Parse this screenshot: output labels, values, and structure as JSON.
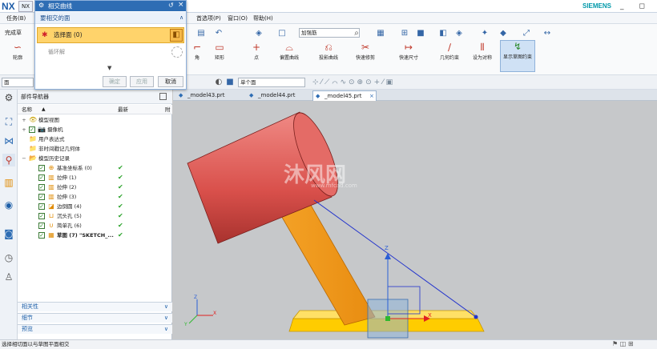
{
  "app": {
    "logo": "NX",
    "tab": "NX",
    "brand": "SIEMENS",
    "window_controls": "_ ◻ ✕"
  },
  "menubar": {
    "items": [
      "任务(B)",
      "首选项(P)",
      "窗口(O)",
      "帮助(H)"
    ]
  },
  "ribbon": {
    "left_label": "完成草",
    "buttons": [
      "轮廓",
      "角",
      "矩形",
      "点",
      "偏置曲线",
      "投影曲线",
      "快速修剪",
      "快速尺寸",
      "几何约束",
      "设为对称",
      "显示草图约束"
    ],
    "combo_value": "加强筋"
  },
  "selbar": {
    "filter_value": "面",
    "scope_value": "单个面"
  },
  "dialog": {
    "title": "相交曲线",
    "section": "要相交的面",
    "select_label": "选择面 (0)",
    "ring_label": "循环解",
    "buttons": [
      "确定",
      "应用",
      "取消"
    ]
  },
  "navigator": {
    "title": "部件导航器",
    "col_name": "名称",
    "col_latest": "最新",
    "col_extra": "附",
    "rows": [
      {
        "label": "模型视图",
        "indent": 0,
        "expander": "+",
        "check": false,
        "icon": "👁",
        "latest": ""
      },
      {
        "label": "摄像机",
        "indent": 0,
        "expander": "+",
        "check": true,
        "icon": "📷",
        "latest": ""
      },
      {
        "label": "用户表达式",
        "indent": 0,
        "expander": "",
        "check": false,
        "icon": "📁",
        "latest": ""
      },
      {
        "label": "非时间戳记几何体",
        "indent": 0,
        "expander": "",
        "check": false,
        "icon": "📁",
        "latest": ""
      },
      {
        "label": "模型历史记录",
        "indent": 0,
        "expander": "−",
        "check": false,
        "icon": "📂",
        "latest": ""
      },
      {
        "label": "基准坐标系 (0)",
        "indent": 1,
        "expander": "",
        "check": true,
        "icon": "⊕",
        "latest": "✔"
      },
      {
        "label": "拉伸 (1)",
        "indent": 1,
        "expander": "",
        "check": true,
        "icon": "▥",
        "latest": "✔"
      },
      {
        "label": "拉伸 (2)",
        "indent": 1,
        "expander": "",
        "check": true,
        "icon": "▥",
        "latest": "✔"
      },
      {
        "label": "拉伸 (3)",
        "indent": 1,
        "expander": "",
        "check": true,
        "icon": "▥",
        "latest": "✔"
      },
      {
        "label": "边倒圆 (4)",
        "indent": 1,
        "expander": "",
        "check": true,
        "icon": "◪",
        "latest": "✔"
      },
      {
        "label": "沉头孔 (5)",
        "indent": 1,
        "expander": "",
        "check": true,
        "icon": "⊔",
        "latest": "✔"
      },
      {
        "label": "简单孔 (6)",
        "indent": 1,
        "expander": "",
        "check": true,
        "icon": "∪",
        "latest": "✔"
      },
      {
        "label": "草图 (7) \"SKETCH_...",
        "indent": 1,
        "expander": "",
        "check": true,
        "icon": "▦",
        "latest": "✔"
      }
    ],
    "panels": [
      "相关性",
      "细节",
      "预览"
    ]
  },
  "tabs": [
    "_model43.prt",
    "_model44.prt",
    "_model45.prt"
  ],
  "viewport": {
    "watermark": "沐风网",
    "watermark_url": "www.mfcad.com",
    "axis_z": "Z",
    "axis_x": "X",
    "axis_y": "Y"
  },
  "status": {
    "message": "选择相切面以与草图平面相交"
  },
  "colors": {
    "accent": "#2e6db4",
    "highlight": "#ffd36b",
    "cylinder": "#d9534f",
    "arm": "#f5a623",
    "base": "#ffcc00"
  }
}
